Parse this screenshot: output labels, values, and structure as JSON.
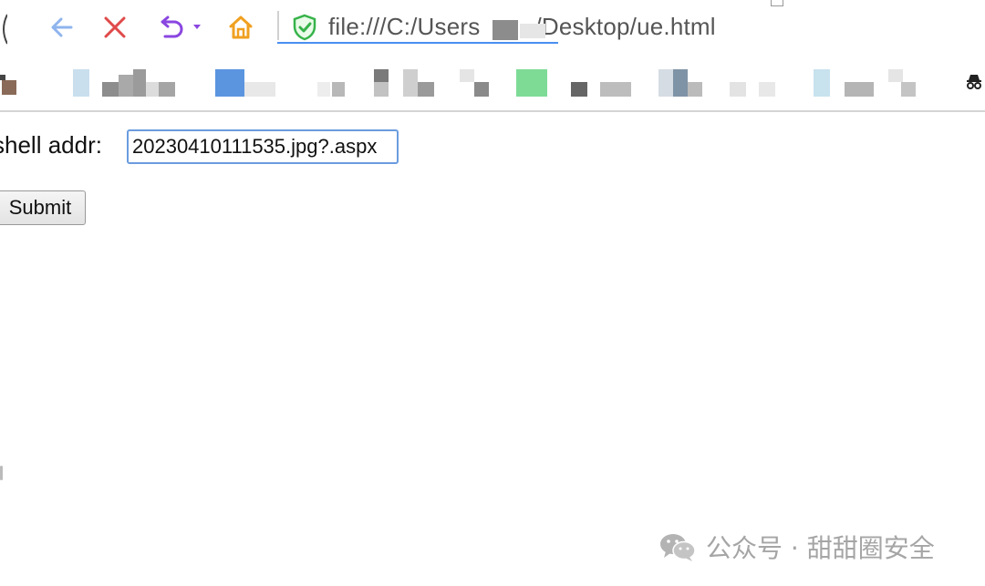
{
  "browser": {
    "toolbar": {
      "back_icon": "arrow-left-icon",
      "stop_icon": "close-icon",
      "undo_icon": "undo-icon",
      "home_icon": "home-icon"
    },
    "address": {
      "url_prefix": "file:///C:/Users",
      "url_suffix": "/Desktop/ue.html",
      "security_icon": "shield-check-icon"
    },
    "colors": {
      "back": "#8fb4ee",
      "stop": "#e04a4a",
      "undo": "#8a46e0",
      "home": "#f0a020",
      "shield": "#36b34a",
      "accent": "#4a8ff0"
    }
  },
  "form": {
    "label": "shell addr:",
    "input_value": "20230410111535.jpg?.aspx",
    "submit_label": "Submit"
  },
  "watermark": {
    "text": "公众号 · 甜甜圈安全",
    "icon": "wechat-icon"
  }
}
